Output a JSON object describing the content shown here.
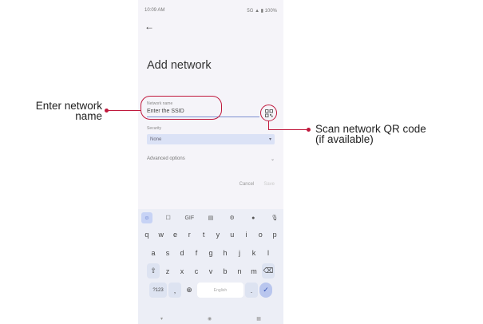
{
  "status_bar": {
    "time": "10:09 AM",
    "indicators": "5G ▲ ▮ 100%"
  },
  "screen": {
    "title": "Add network",
    "network_name": {
      "label": "Network name",
      "placeholder": "Enter the SSID"
    },
    "security": {
      "label": "Security",
      "value": "None"
    },
    "advanced_options": "Advanced options",
    "cancel": "Cancel",
    "save": "Save"
  },
  "keyboard": {
    "row1": [
      "q",
      "w",
      "e",
      "r",
      "t",
      "y",
      "u",
      "i",
      "o",
      "p"
    ],
    "row2": [
      "a",
      "s",
      "d",
      "f",
      "g",
      "h",
      "j",
      "k",
      "l"
    ],
    "row3": [
      "z",
      "x",
      "c",
      "v",
      "b",
      "n",
      "m"
    ],
    "symbols_key": "?123",
    "space_label": "English",
    "gif_label": "GIF"
  },
  "annotations": {
    "left": [
      "Enter network",
      "name"
    ],
    "right": [
      "Scan network QR code",
      "(if available)"
    ]
  },
  "colors": {
    "accent": "#c0183c",
    "field_underline": "#7b8fd0",
    "dropdown_bg": "#dbe2f6"
  },
  "icons": [
    "back-arrow-icon",
    "qr-scan-icon",
    "chevron-down-icon",
    "emoji-icon",
    "sticker-icon",
    "clipboard-icon",
    "gear-icon",
    "palette-icon",
    "mic-icon",
    "shift-icon",
    "backspace-icon",
    "comma-icon",
    "globe-icon",
    "check-icon"
  ]
}
